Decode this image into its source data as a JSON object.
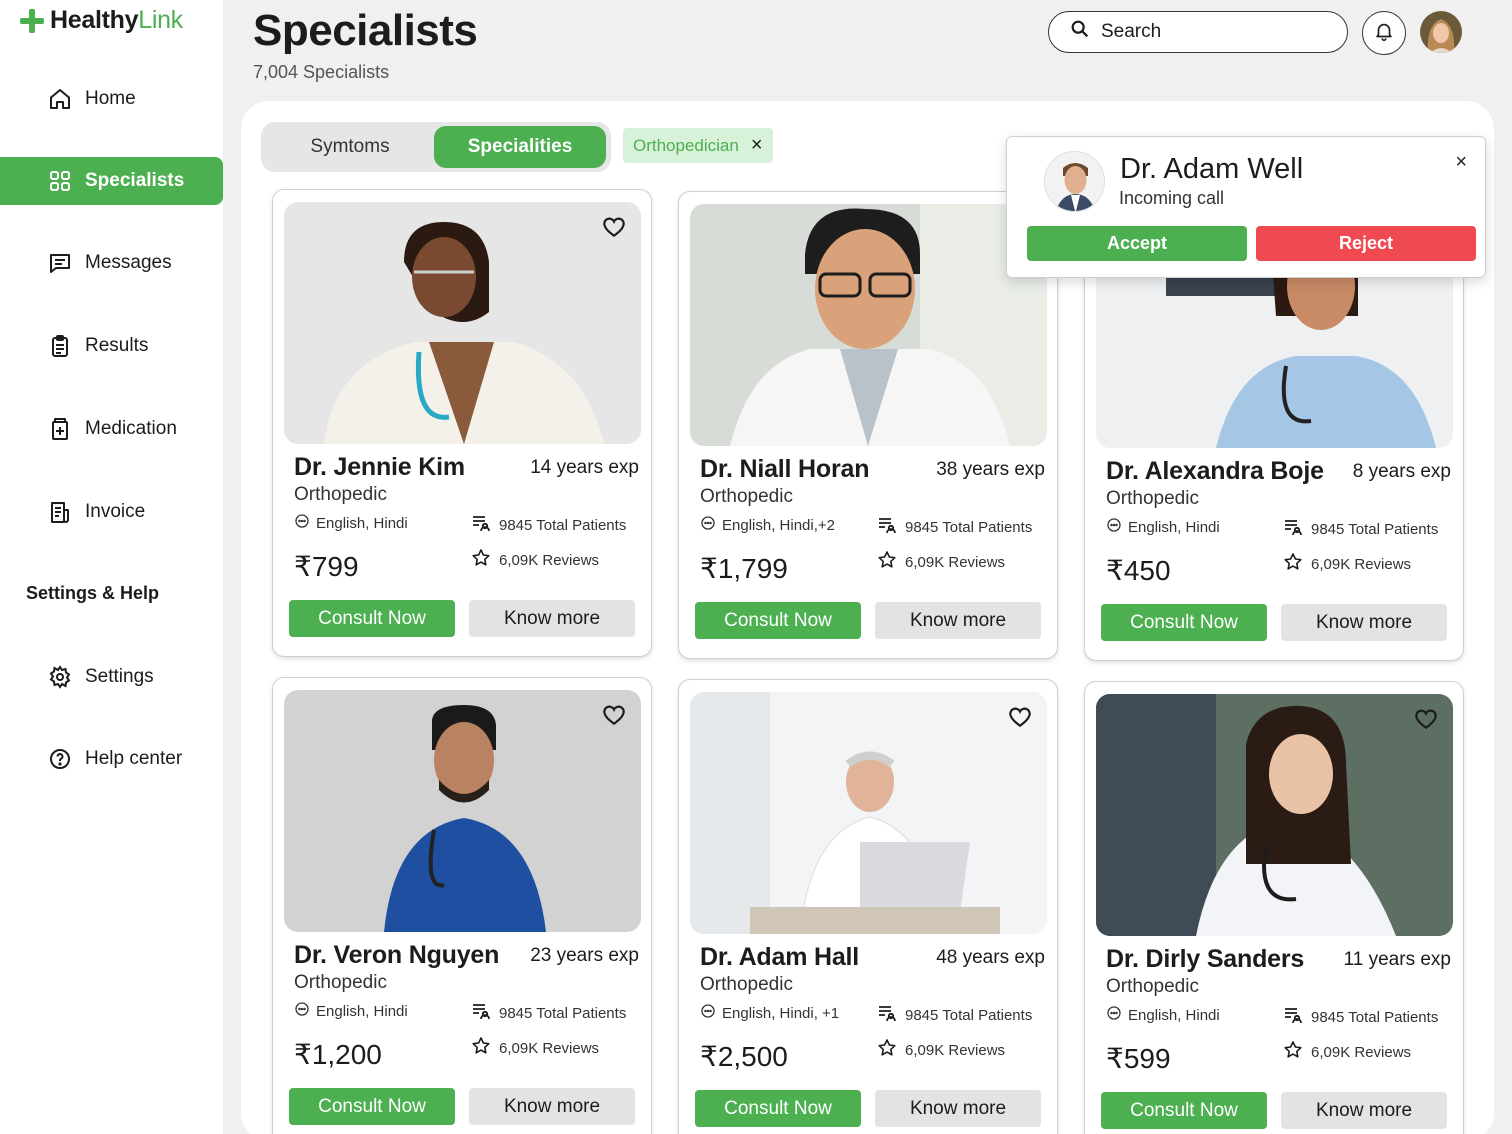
{
  "app": {
    "name_part1": "Healthy",
    "name_part2": "Link",
    "brand_color": "#4caf50"
  },
  "sidebar": {
    "items": [
      {
        "label": "Home",
        "icon": "home-icon"
      },
      {
        "label": "Specialists",
        "icon": "grid-icon",
        "active": true
      },
      {
        "label": "Messages",
        "icon": "message-icon"
      },
      {
        "label": "Results",
        "icon": "clipboard-icon"
      },
      {
        "label": "Medication",
        "icon": "medication-icon"
      },
      {
        "label": "Invoice",
        "icon": "invoice-icon"
      }
    ],
    "section_title": "Settings & Help",
    "bottom_items": [
      {
        "label": "Settings",
        "icon": "gear-icon"
      },
      {
        "label": "Help center",
        "icon": "help-icon"
      }
    ]
  },
  "header": {
    "title": "Specialists",
    "subtitle": "7,004 Specialists"
  },
  "search": {
    "label": "Search"
  },
  "filters": {
    "tab_a": "Symtoms",
    "tab_b": "Specialities",
    "active_tab": "Specialities",
    "chip": "Orthopedician"
  },
  "call": {
    "name": "Dr. Adam Well",
    "status": "Incoming call",
    "accept": "Accept",
    "reject": "Reject",
    "close": "×",
    "reject_color": "#ef4a52"
  },
  "cards": [
    {
      "name": "Dr. Jennie Kim",
      "exp": "14 years exp",
      "spec": "Orthopedic",
      "langs": "English, Hindi",
      "patients": "9845 Total Patients",
      "reviews": "6,09K Reviews",
      "price": "₹799",
      "consult": "Consult Now",
      "more": "Know more"
    },
    {
      "name": "Dr. Niall Horan",
      "exp": "38 years exp",
      "spec": "Orthopedic",
      "langs": "English, Hindi,+2",
      "patients": "9845 Total Patients",
      "reviews": "6,09K Reviews",
      "price": "₹1,799",
      "consult": "Consult Now",
      "more": "Know more"
    },
    {
      "name": "Dr. Alexandra Boje",
      "exp": "8 years exp",
      "spec": "Orthopedic",
      "langs": "English, Hindi",
      "patients": "9845 Total Patients",
      "reviews": "6,09K Reviews",
      "price": "₹450",
      "consult": "Consult Now",
      "more": "Know more"
    },
    {
      "name": "Dr. Veron Nguyen",
      "exp": "23 years exp",
      "spec": "Orthopedic",
      "langs": "English, Hindi",
      "patients": "9845 Total Patients",
      "reviews": "6,09K Reviews",
      "price": "₹1,200",
      "consult": "Consult Now",
      "more": "Know more"
    },
    {
      "name": "Dr. Adam Hall",
      "exp": "48 years exp",
      "spec": "Orthopedic",
      "langs": "English, Hindi, +1",
      "patients": "9845 Total Patients",
      "reviews": "6,09K Reviews",
      "price": "₹2,500",
      "consult": "Consult Now",
      "more": "Know more"
    },
    {
      "name": "Dr. Dirly Sanders",
      "exp": "11 years exp",
      "spec": "Orthopedic",
      "langs": "English, Hindi",
      "patients": "9845 Total Patients",
      "reviews": "6,09K Reviews",
      "price": "₹599",
      "consult": "Consult Now",
      "more": "Know more"
    }
  ]
}
